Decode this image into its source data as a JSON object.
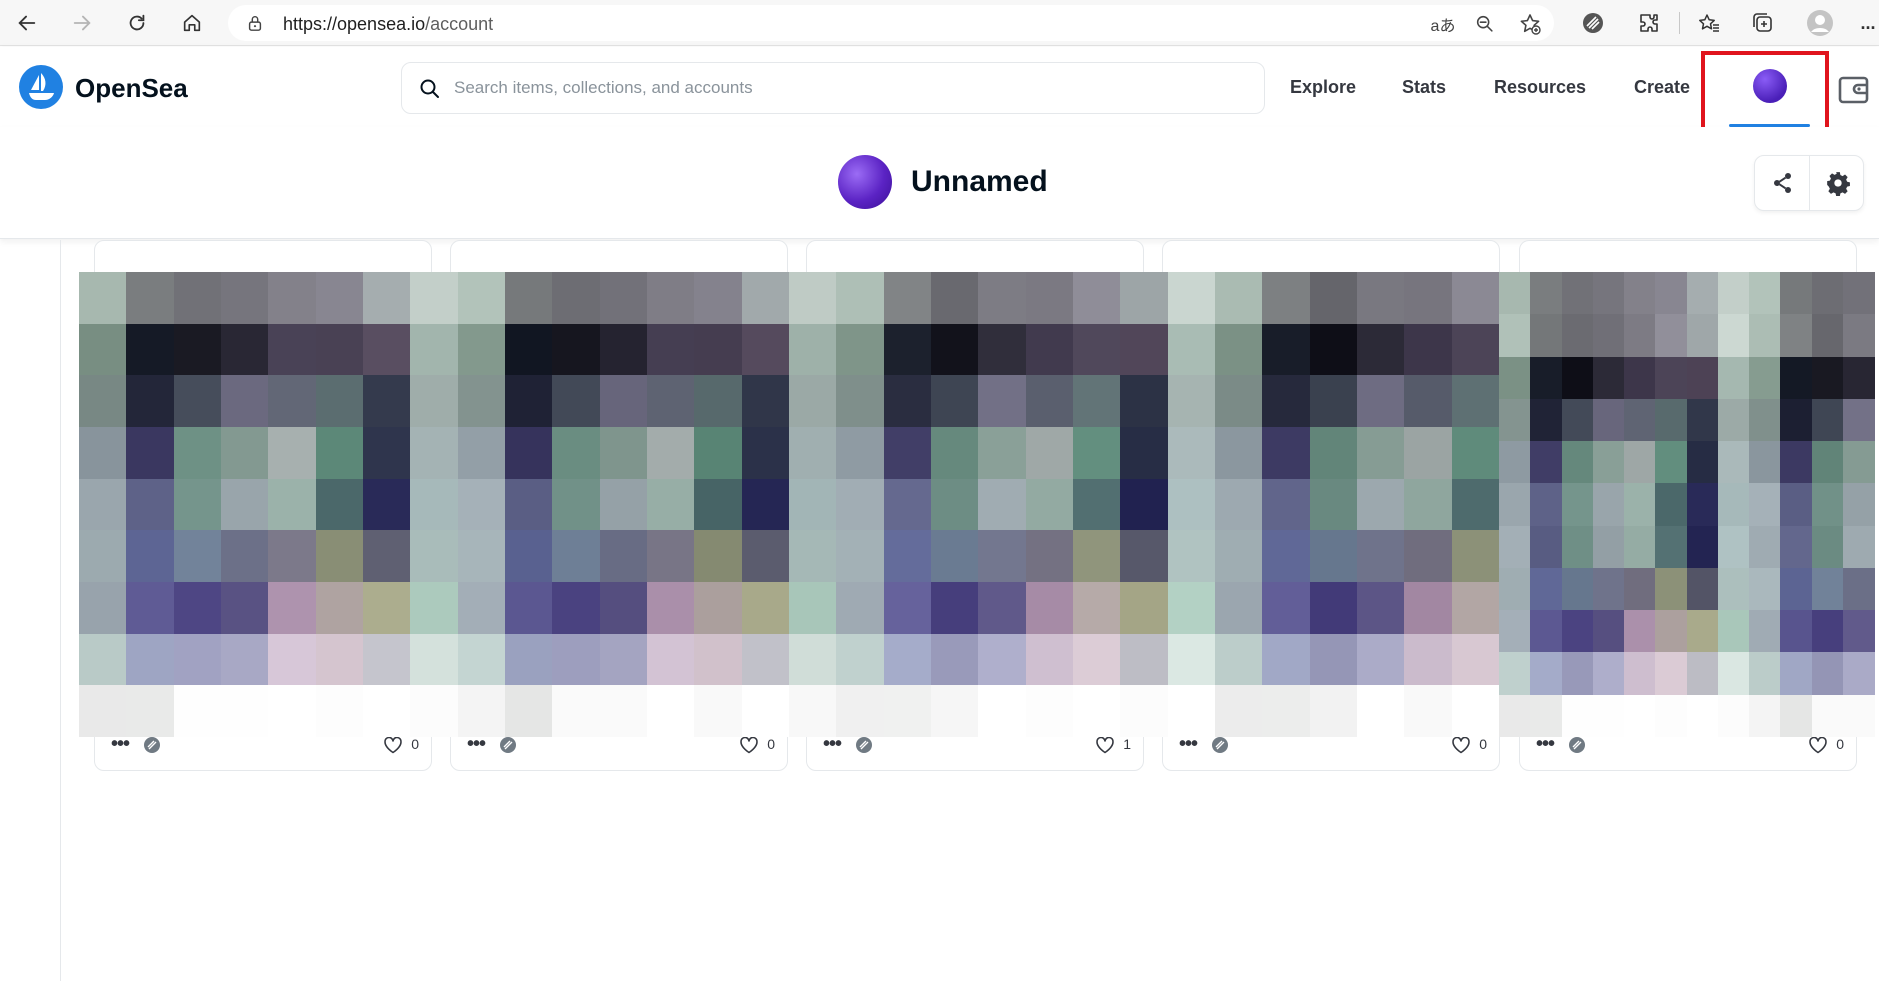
{
  "browser": {
    "url_domain": "https://opensea.io",
    "url_path": "/account",
    "icons": [
      "back-arrow-icon",
      "forward-arrow-icon",
      "reload-icon",
      "home-icon",
      "lock-icon",
      "translate-icon",
      "zoom-icon",
      "favorite-star-icon",
      "opensea-extension-icon",
      "extensions-puzzle-icon",
      "favorites-icon",
      "collections-icon",
      "profile-icon",
      "more-icon"
    ],
    "translate_glyph": "aあ",
    "more_glyph": "..."
  },
  "header": {
    "brand": "OpenSea",
    "search_placeholder": "Search items, collections, and accounts",
    "nav": [
      "Explore",
      "Stats",
      "Resources",
      "Create"
    ],
    "brand_color": "#2081e2",
    "highlight_color": "#e0141d"
  },
  "profile": {
    "name": "Unnamed",
    "actions": [
      "share-icon",
      "settings-gear-icon"
    ]
  },
  "cards": [
    {
      "likes": "0"
    },
    {
      "likes": "0"
    },
    {
      "likes": "1"
    },
    {
      "likes": "0"
    },
    {
      "likes": "0"
    }
  ]
}
